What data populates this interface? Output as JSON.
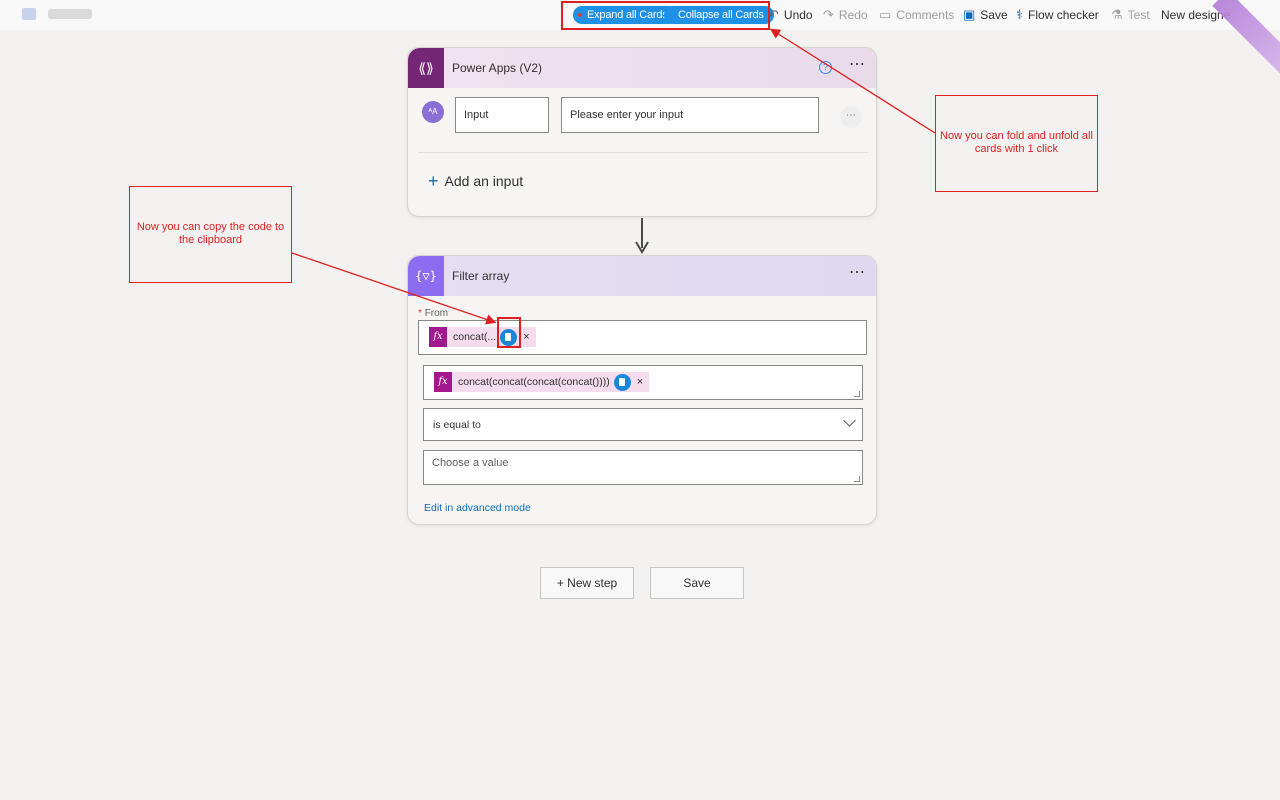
{
  "toolbar": {
    "expand_all": "Expand all Cards",
    "collapse_all": "Collapse all Cards",
    "undo": "Undo",
    "redo": "Redo",
    "comments": "Comments",
    "save": "Save",
    "flow_checker": "Flow checker",
    "test": "Test",
    "new_designer": "New designe"
  },
  "trigger_card": {
    "title": "Power Apps (V2)",
    "more": "⋯",
    "avatar": "ᴬA",
    "input_name": "Input",
    "input_prompt": "Please enter your input",
    "input_more": "⋯",
    "add_input": "Add an input",
    "info": "?"
  },
  "filter_card": {
    "title": "Filter array",
    "more": "⋯",
    "icon": "{▽}",
    "from_label": "From",
    "from_required": "*",
    "from_token": "concat(...",
    "left_token": "concat(concat(concat(concat())))",
    "fx": "fx",
    "remove": "×",
    "operator": "is equal to",
    "value_placeholder": "Choose a value",
    "advanced_link": "Edit in advanced mode"
  },
  "actions": {
    "new_step": "+ New step",
    "save": "Save"
  },
  "annotations": {
    "fold": "Now you can fold and unfold all cards with 1 click",
    "copy": "Now you can copy the code to the clipboard"
  },
  "colors": {
    "accent": "#1e90e6",
    "annotation": "#e02020",
    "power_apps": "#742774",
    "filter": "#8c6cf0",
    "expression_token": "#a1198c"
  }
}
